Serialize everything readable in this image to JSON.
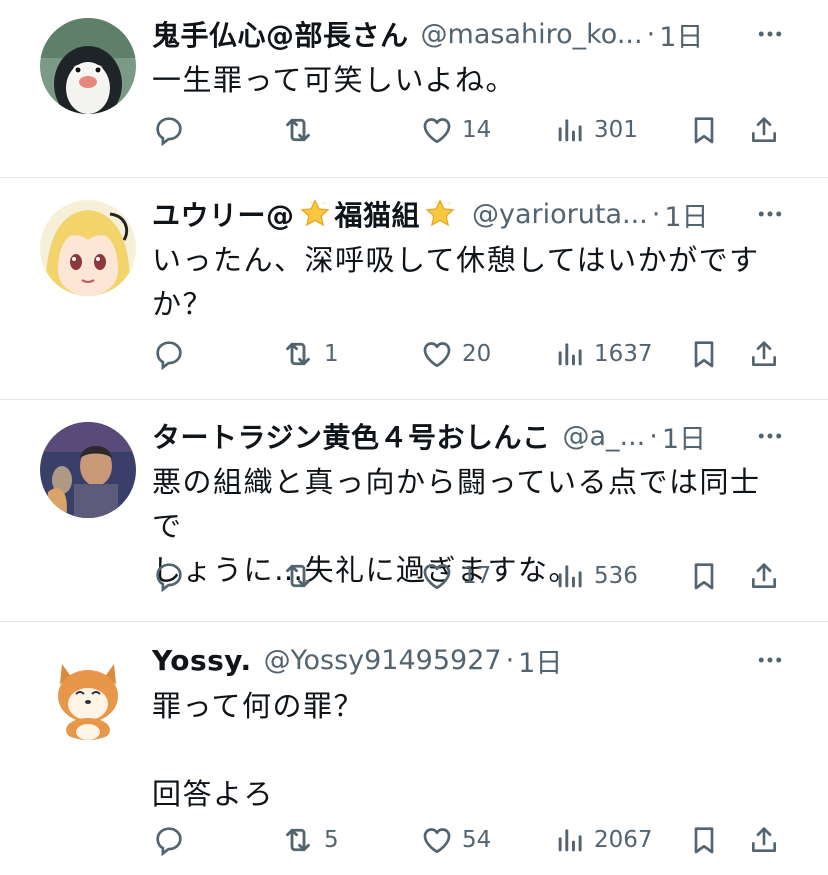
{
  "tweets": [
    {
      "name": "鬼手仏心@部長さん",
      "handle": "@masahiro_ko...",
      "time": "1日",
      "text": "一生罪って可笑しいよね。",
      "replies": "",
      "retweets": "",
      "likes": "14",
      "views": "301"
    },
    {
      "name_part1": "ユウリー@",
      "name_part2": "福猫組",
      "handle": "@yarioruta...",
      "time": "1日",
      "text": "いったん、深呼吸して休憩してはいかがです\nか？",
      "replies": "",
      "retweets": "1",
      "likes": "20",
      "views": "1637"
    },
    {
      "name": "タートラジン黄色４号おしんこ",
      "handle": "@a_...",
      "time": "1日",
      "text": "悪の組織と真っ向から闘っている点では同士で\nしょうに…失礼に過ぎますな。",
      "replies": "",
      "retweets": "",
      "likes": "17",
      "views": "536"
    },
    {
      "name": "Yossy.",
      "handle": "@Yossy91495927",
      "time": "1日",
      "text": "罪って何の罪？\n\n回答よろ",
      "replies": "",
      "retweets": "5",
      "likes": "54",
      "views": "2067"
    }
  ],
  "separator": "·",
  "icons": [
    "reply-icon",
    "retweet-icon",
    "like-icon",
    "views-icon",
    "bookmark-icon",
    "share-icon",
    "more-icon"
  ]
}
